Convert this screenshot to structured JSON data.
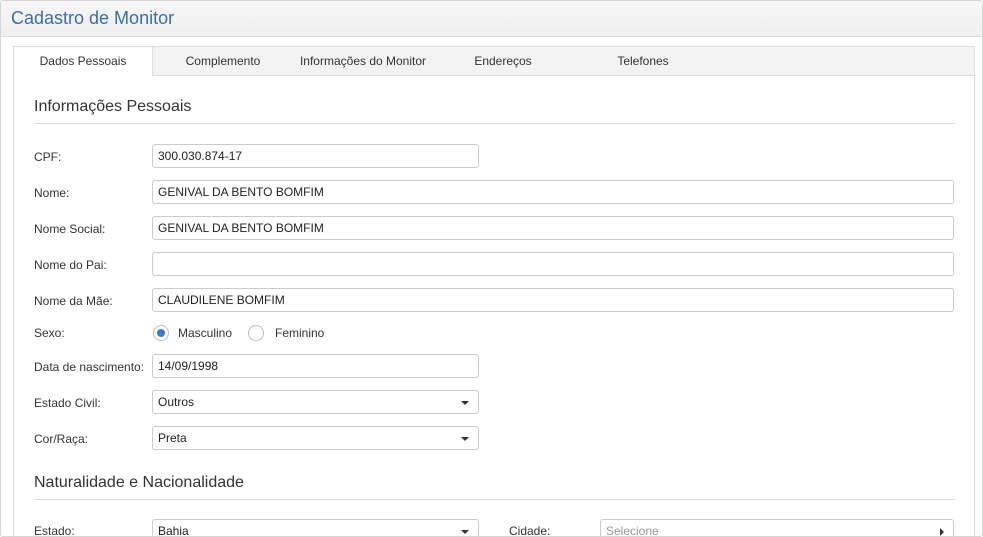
{
  "window": {
    "title": "Cadastro de Monitor"
  },
  "tabs": [
    {
      "label": "Dados Pessoais"
    },
    {
      "label": "Complemento"
    },
    {
      "label": "Informações do Monitor"
    },
    {
      "label": "Endereços"
    },
    {
      "label": "Telefones"
    }
  ],
  "sections": {
    "personal": "Informações Pessoais",
    "birthplace": "Naturalidade e Nacionalidade"
  },
  "fields": {
    "cpf": {
      "label": "CPF:",
      "value": "300.030.874-17"
    },
    "nome": {
      "label": "Nome:",
      "value": "GENIVAL DA BENTO BOMFIM"
    },
    "nome_social": {
      "label": "Nome Social:",
      "value": "GENIVAL DA BENTO BOMFIM"
    },
    "nome_pai": {
      "label": "Nome do Pai:",
      "value": ""
    },
    "nome_mae": {
      "label": "Nome da Mãe:",
      "value": "CLAUDILENE BOMFIM"
    },
    "sexo": {
      "label": "Sexo:",
      "option_m": "Masculino",
      "option_f": "Feminino",
      "selected": "Masculino"
    },
    "nascimento": {
      "label": "Data de nascimento:",
      "value": "14/09/1998"
    },
    "estado_civil": {
      "label": "Estado Civil:",
      "value": "Outros"
    },
    "cor_raca": {
      "label": "Cor/Raça:",
      "value": "Preta"
    },
    "estado": {
      "label": "Estado:",
      "value": "Bahia"
    },
    "cidade": {
      "label": "Cidade:",
      "placeholder": "Selecione"
    }
  },
  "colors": {
    "accent": "#3a6ea5",
    "radio_selected": "#3a7bd5"
  }
}
